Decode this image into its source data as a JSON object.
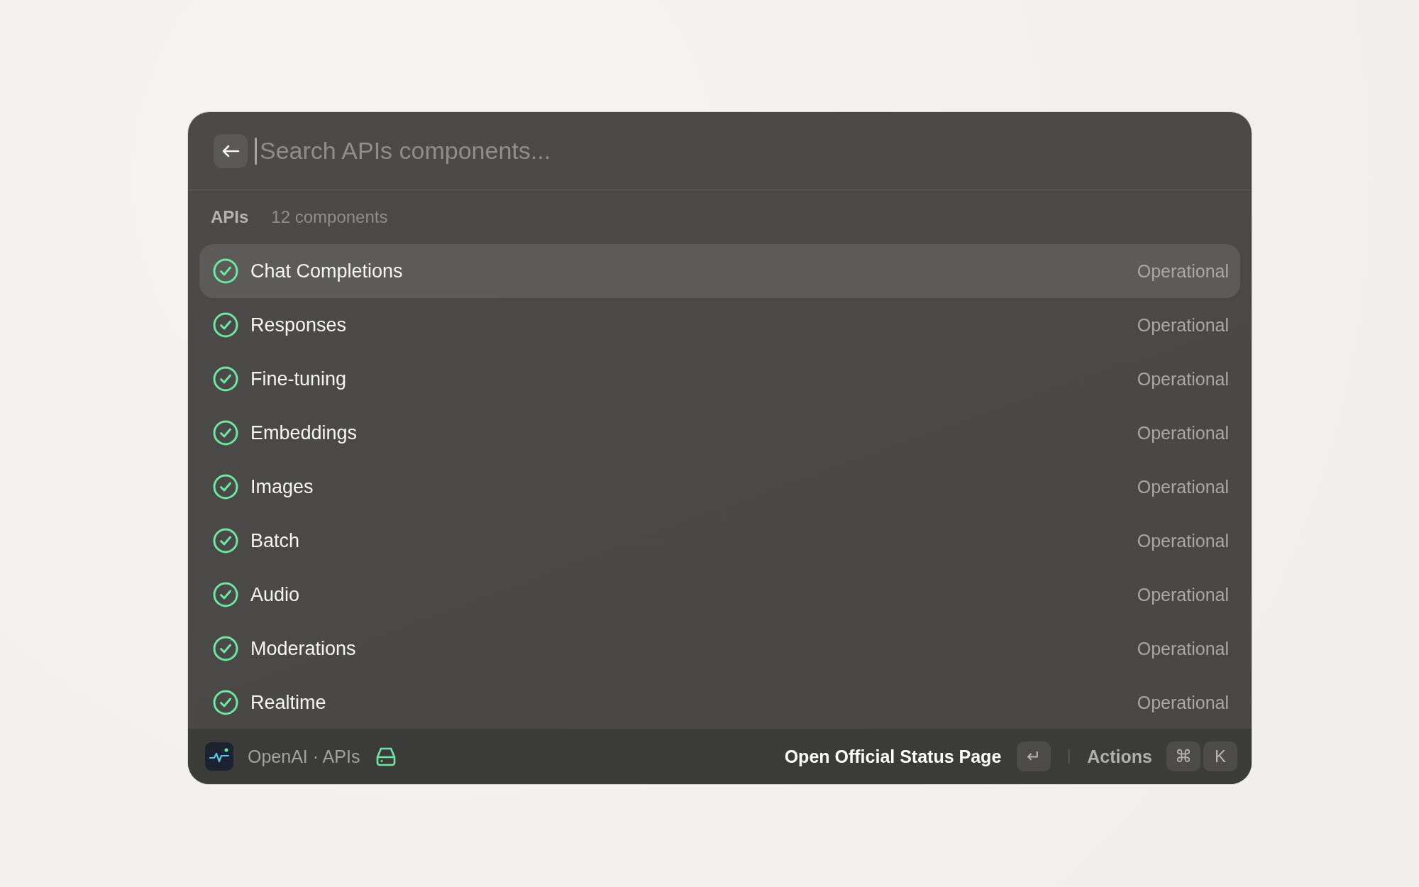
{
  "search": {
    "placeholder": "Search APIs components..."
  },
  "section": {
    "title": "APIs",
    "count": "12 components"
  },
  "components": [
    {
      "name": "Chat Completions",
      "status": "Operational",
      "selected": true
    },
    {
      "name": "Responses",
      "status": "Operational",
      "selected": false
    },
    {
      "name": "Fine-tuning",
      "status": "Operational",
      "selected": false
    },
    {
      "name": "Embeddings",
      "status": "Operational",
      "selected": false
    },
    {
      "name": "Images",
      "status": "Operational",
      "selected": false
    },
    {
      "name": "Batch",
      "status": "Operational",
      "selected": false
    },
    {
      "name": "Audio",
      "status": "Operational",
      "selected": false
    },
    {
      "name": "Moderations",
      "status": "Operational",
      "selected": false
    },
    {
      "name": "Realtime",
      "status": "Operational",
      "selected": false
    }
  ],
  "footer": {
    "breadcrumb": "OpenAI · APIs",
    "primary_action": "Open Official Status Page",
    "primary_key": "↵",
    "actions_label": "Actions",
    "action_keys": [
      "⌘",
      "K"
    ]
  }
}
